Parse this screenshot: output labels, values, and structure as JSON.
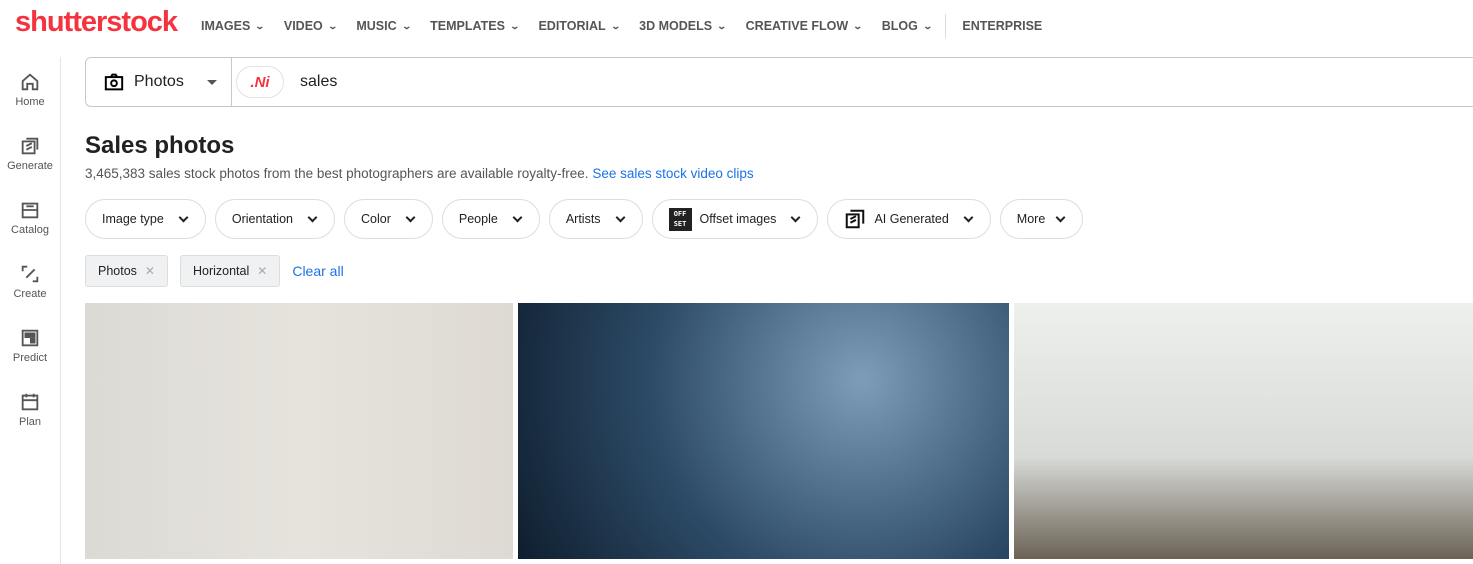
{
  "brand": {
    "logo": "shutterstock",
    "color": "#f5333f"
  },
  "nav": [
    {
      "label": "IMAGES"
    },
    {
      "label": "VIDEO"
    },
    {
      "label": "MUSIC"
    },
    {
      "label": "TEMPLATES"
    },
    {
      "label": "EDITORIAL"
    },
    {
      "label": "3D MODELS"
    },
    {
      "label": "CREATIVE FLOW"
    },
    {
      "label": "BLOG"
    }
  ],
  "nav_enterprise": "ENTERPRISE",
  "sidebar": [
    {
      "label": "Home",
      "icon": "home-icon"
    },
    {
      "label": "Generate",
      "icon": "generate-icon"
    },
    {
      "label": "Catalog",
      "icon": "catalog-icon"
    },
    {
      "label": "Create",
      "icon": "create-icon"
    },
    {
      "label": "Predict",
      "icon": "predict-icon"
    },
    {
      "label": "Plan",
      "icon": "plan-icon"
    }
  ],
  "search": {
    "type": "Photos",
    "ai_label": ".Ni",
    "query": "sales"
  },
  "page": {
    "title": "Sales photos",
    "subtitle": "3,465,383 sales stock photos from the best photographers are available royalty-free.",
    "link": "See sales stock video clips"
  },
  "filters": [
    {
      "label": "Image type"
    },
    {
      "label": "Orientation"
    },
    {
      "label": "Color"
    },
    {
      "label": "People"
    },
    {
      "label": "Artists"
    },
    {
      "label": "Offset images",
      "badge": "OFF SET"
    },
    {
      "label": "AI Generated"
    },
    {
      "label": "More"
    }
  ],
  "active_tags": [
    {
      "label": "Photos"
    },
    {
      "label": "Horizontal"
    }
  ],
  "clear_all": "Clear all",
  "accent": "#1a73e8"
}
